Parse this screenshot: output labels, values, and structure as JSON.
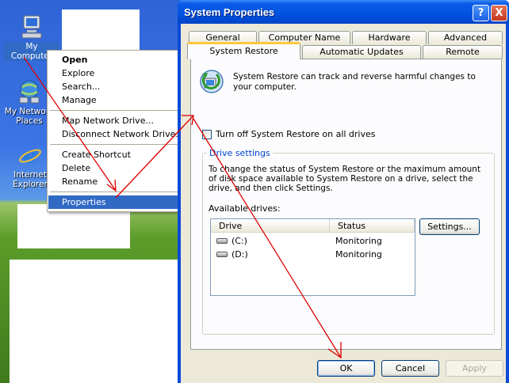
{
  "desktop": {
    "icons": [
      {
        "label": "My Computer",
        "icon": "my-computer-icon"
      },
      {
        "label": "My Network Places",
        "icon": "network-places-icon"
      },
      {
        "label": "Internet Explorer",
        "icon": "internet-explorer-icon"
      }
    ]
  },
  "context_menu": {
    "items": [
      "Open",
      "Explore",
      "Search...",
      "Manage",
      "Map Network Drive...",
      "Disconnect Network Drive...",
      "Create Shortcut",
      "Delete",
      "Rename",
      "Properties"
    ]
  },
  "window": {
    "title": "System Properties",
    "help_glyph": "?",
    "close_glyph": "X",
    "tabs_back": [
      "General",
      "Computer Name",
      "Hardware",
      "Advanced"
    ],
    "tabs_front": [
      "System Restore",
      "Automatic Updates",
      "Remote"
    ],
    "intro": "System Restore can track and reverse harmful changes to your computer.",
    "checkbox_label": "Turn off System Restore on all drives",
    "checkbox_checked": false,
    "group_label": "Drive settings",
    "group_text": "To change the status of System Restore or the maximum amount of disk space available to System Restore on a drive, select the drive, and then click Settings.",
    "available_drives_label": "Available drives:",
    "columns": [
      "Drive",
      "Status"
    ],
    "drives": [
      {
        "drive": "(C:)",
        "status": "Monitoring"
      },
      {
        "drive": "(D:)",
        "status": "Monitoring"
      }
    ],
    "settings_button": "Settings...",
    "ok_button": "OK",
    "cancel_button": "Cancel",
    "apply_button": "Apply"
  },
  "colors": {
    "annotation_arrow": "#e00000",
    "selection": "#316ac5",
    "title_bar": "#0a5ce8"
  }
}
